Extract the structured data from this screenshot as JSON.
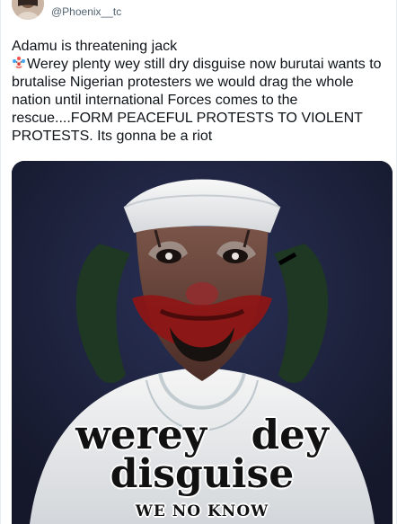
{
  "header": {
    "handle": "@Phoenix__tc"
  },
  "tweet": {
    "line1": "Adamu is threatening jack",
    "body": "Werey plenty wey still dry disguise now burutai wants to brutalise Nigerian protesters we would drag the whole nation until international Forces comes to the rescue....FORM PEACEFUL PROTESTS TO VIOLENT PROTESTS.  Its gonna be a riot",
    "emoji": "clown-face-emoji"
  },
  "image": {
    "overlay_line1": "werey dey",
    "overlay_line2": "disguise",
    "overlay_line3": "WE NO KNOW"
  },
  "colors": {
    "text": "#0f1419",
    "secondary_text": "#536471",
    "image_background": "#1e2340",
    "accent_red": "#b71c1c",
    "clown_white": "#f1efe9"
  }
}
